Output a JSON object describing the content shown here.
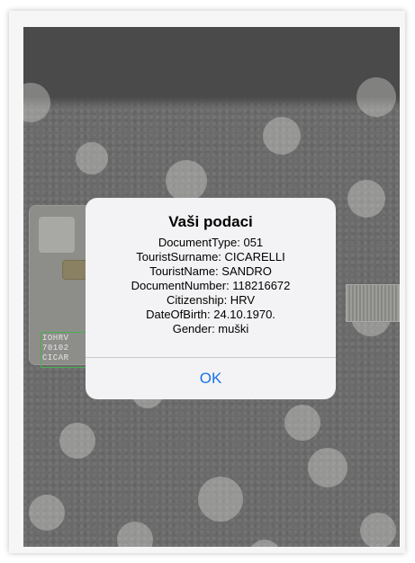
{
  "card": {
    "mrz_lines": [
      "IOHRV",
      "70102",
      "CICAR"
    ]
  },
  "dialog": {
    "title": "Vaši podaci",
    "lines": [
      "DocumentType: 051",
      "TouristSurname: CICARELLI",
      "TouristName: SANDRO",
      "DocumentNumber: 118216672",
      "Citizenship: HRV",
      "DateOfBirth: 24.10.1970.",
      "Gender: muški"
    ],
    "ok_label": "OK"
  },
  "colors": {
    "accent": "#1a73e8",
    "dialog_bg": "#f3f3f5"
  }
}
